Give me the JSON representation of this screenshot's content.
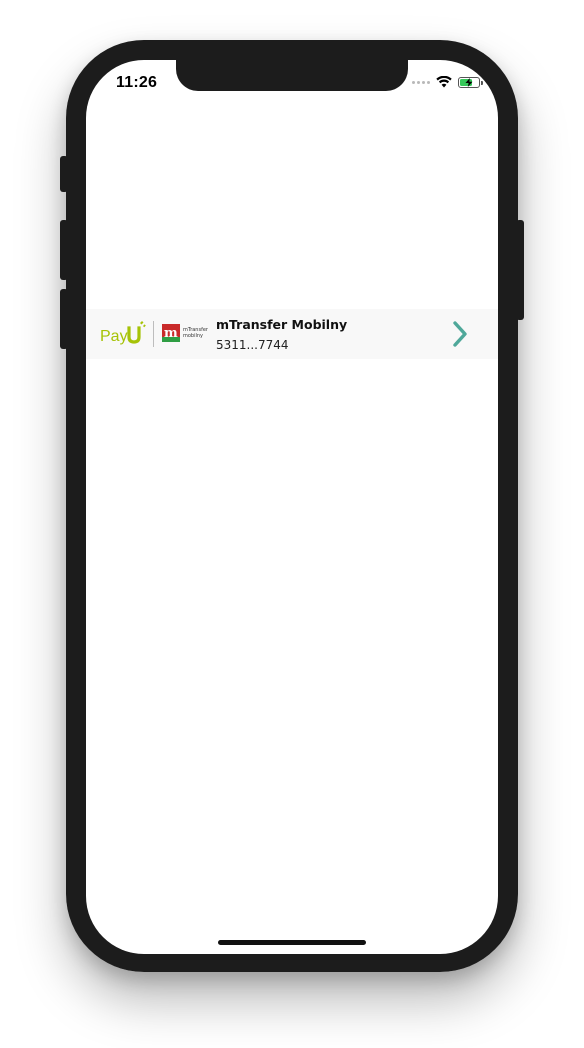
{
  "status_bar": {
    "time": "11:26",
    "battery_level": 0.6,
    "battery_charging": true
  },
  "payment_method": {
    "provider_logo": "PayU",
    "method_logo_alt": "mTransfer mobilny",
    "name": "mTransfer Mobilny",
    "account": "5311...7744",
    "chevron_icon": "chevron-right-icon"
  },
  "colors": {
    "payu_green": "#a6c307",
    "mbank_red": "#c92a2a",
    "chevron_teal": "#4fa89a",
    "row_background": "#f8f8f8"
  }
}
